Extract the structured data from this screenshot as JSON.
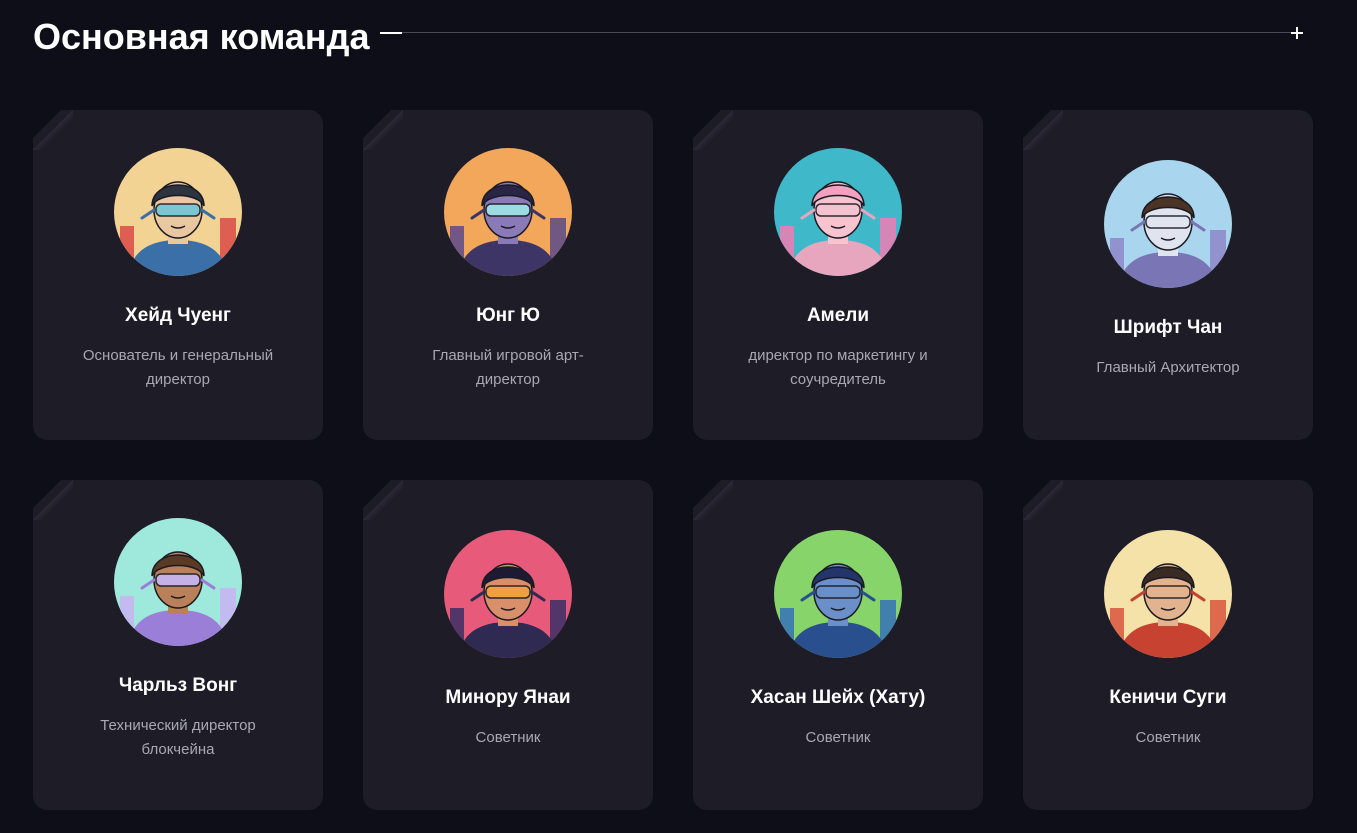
{
  "section": {
    "title": "Основная команда"
  },
  "members": [
    {
      "name": "Хейд Чуенг",
      "role": "Основатель и генеральный директор",
      "avatar": {
        "bg": "#f3d394",
        "accent": "#d94a45",
        "skin": "#e9c7a0",
        "gear": "#3b6fa8",
        "visor": "#6fc7d6",
        "hair": "#2b3440"
      }
    },
    {
      "name": "Юнг Ю",
      "role": "Главный игровой арт-директор",
      "avatar": {
        "bg": "#f2a75a",
        "accent": "#5a4a8c",
        "skin": "#8a7bb8",
        "gear": "#3d3566",
        "visor": "#9de6e6",
        "hair": "#2a2547"
      }
    },
    {
      "name": "Амели",
      "role": "директор по маркетингу и соучредитель",
      "avatar": {
        "bg": "#3fb8c9",
        "accent": "#f07bb3",
        "skin": "#f6c3cf",
        "gear": "#e7a6bd",
        "visor": "#f6c3cf",
        "hair": "#f2a2c0"
      }
    },
    {
      "name": "Шрифт Чан",
      "role": "Главный Архитектор",
      "avatar": {
        "bg": "#a9d6ee",
        "accent": "#8e86c9",
        "skin": "#dfe4ee",
        "gear": "#7a76b5",
        "visor": "#dfe4ee",
        "hair": "#4b3326"
      }
    },
    {
      "name": "Чарльз Вонг",
      "role": "Технический директор блокчейна",
      "avatar": {
        "bg": "#9fe8dc",
        "accent": "#c9b3f2",
        "skin": "#b9805a",
        "gear": "#9b7ed8",
        "visor": "#c8b6f5",
        "hair": "#5b3a24"
      }
    },
    {
      "name": "Минору Янаи",
      "role": "Советник",
      "avatar": {
        "bg": "#e85a7a",
        "accent": "#3a2f66",
        "skin": "#d9906a",
        "gear": "#2e2a52",
        "visor": "#f2a13d",
        "hair": "#1f1a33"
      }
    },
    {
      "name": "Хасан Шейх (Хату)",
      "role": "Советник",
      "avatar": {
        "bg": "#86d46a",
        "accent": "#3570b8",
        "skin": "#6a8fc9",
        "gear": "#2a4f8f",
        "visor": "#6a8fc9",
        "hair": "#24356b"
      }
    },
    {
      "name": "Кеничи Суги",
      "role": "Советник",
      "avatar": {
        "bg": "#f4e2a8",
        "accent": "#d8553d",
        "skin": "#e3b38f",
        "gear": "#c84232",
        "visor": "#e3b38f",
        "hair": "#3a2a24"
      }
    }
  ]
}
